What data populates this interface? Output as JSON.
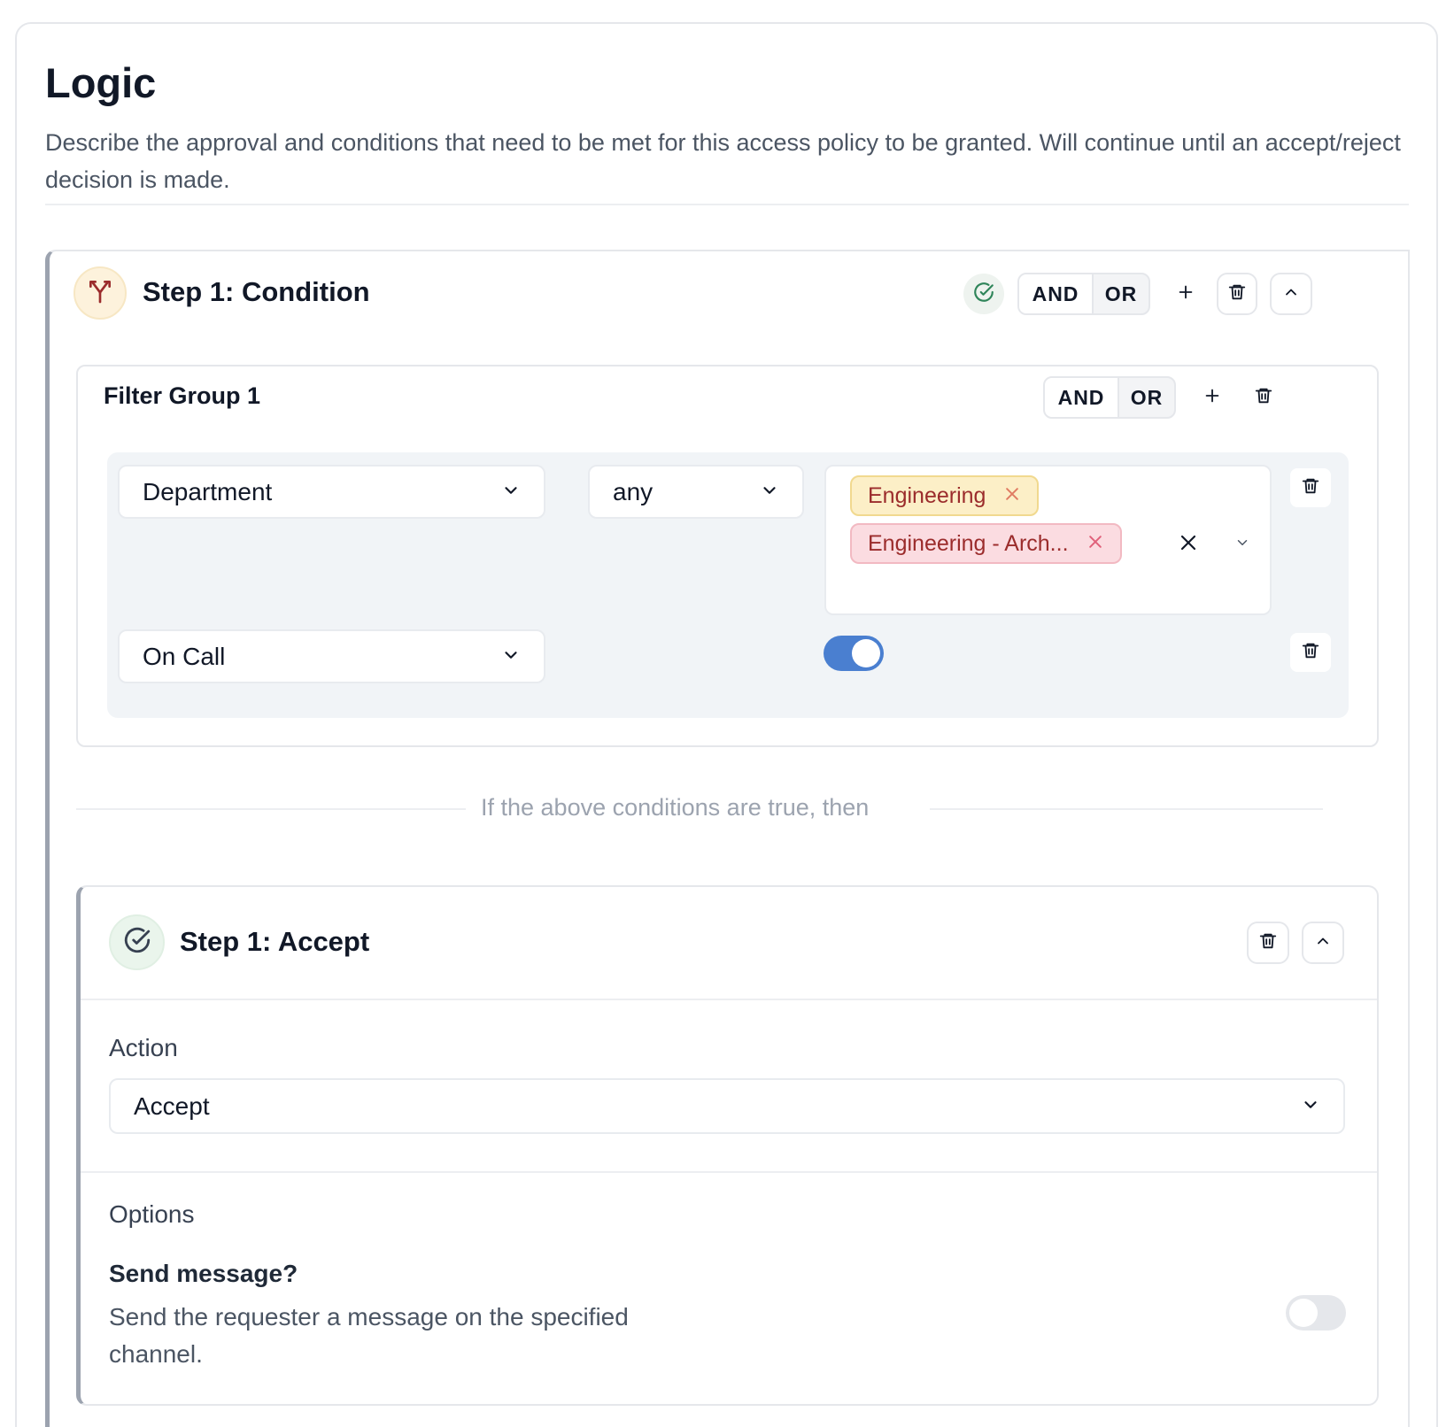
{
  "page": {
    "title": "Logic",
    "description": "Describe the approval and conditions that need to be met for this access policy to be granted. Will continue until an accept/reject decision is made."
  },
  "condition_step": {
    "title": "Step 1: Condition",
    "icon": "split-arrows-icon",
    "and_label": "AND",
    "or_label": "OR",
    "selected_operator": "AND"
  },
  "filter_group": {
    "title": "Filter Group 1",
    "and_label": "AND",
    "or_label": "OR",
    "selected_operator": "AND",
    "rules": [
      {
        "field": "Department",
        "operator": "any",
        "values": [
          "Engineering",
          "Engineering - Arch..."
        ]
      },
      {
        "field": "On Call",
        "toggle_on": true
      }
    ]
  },
  "divider": {
    "text": "If the above conditions are true, then"
  },
  "accept_step": {
    "title": "Step 1: Accept",
    "icon": "check-circle-icon",
    "action_label": "Action",
    "action_value": "Accept",
    "options_label": "Options",
    "send_message": {
      "label": "Send message?",
      "help": "Send the requester a message on the specified channel.",
      "toggle_on": false
    }
  },
  "colors": {
    "accent_blue": "#4a7fd0",
    "tag_yellow_bg": "#fcefc7",
    "tag_red_bg": "#fbdce1",
    "tag_text": "#9b2c2c",
    "condition_icon": "#9b2c2c",
    "check_green": "#2f855a"
  }
}
